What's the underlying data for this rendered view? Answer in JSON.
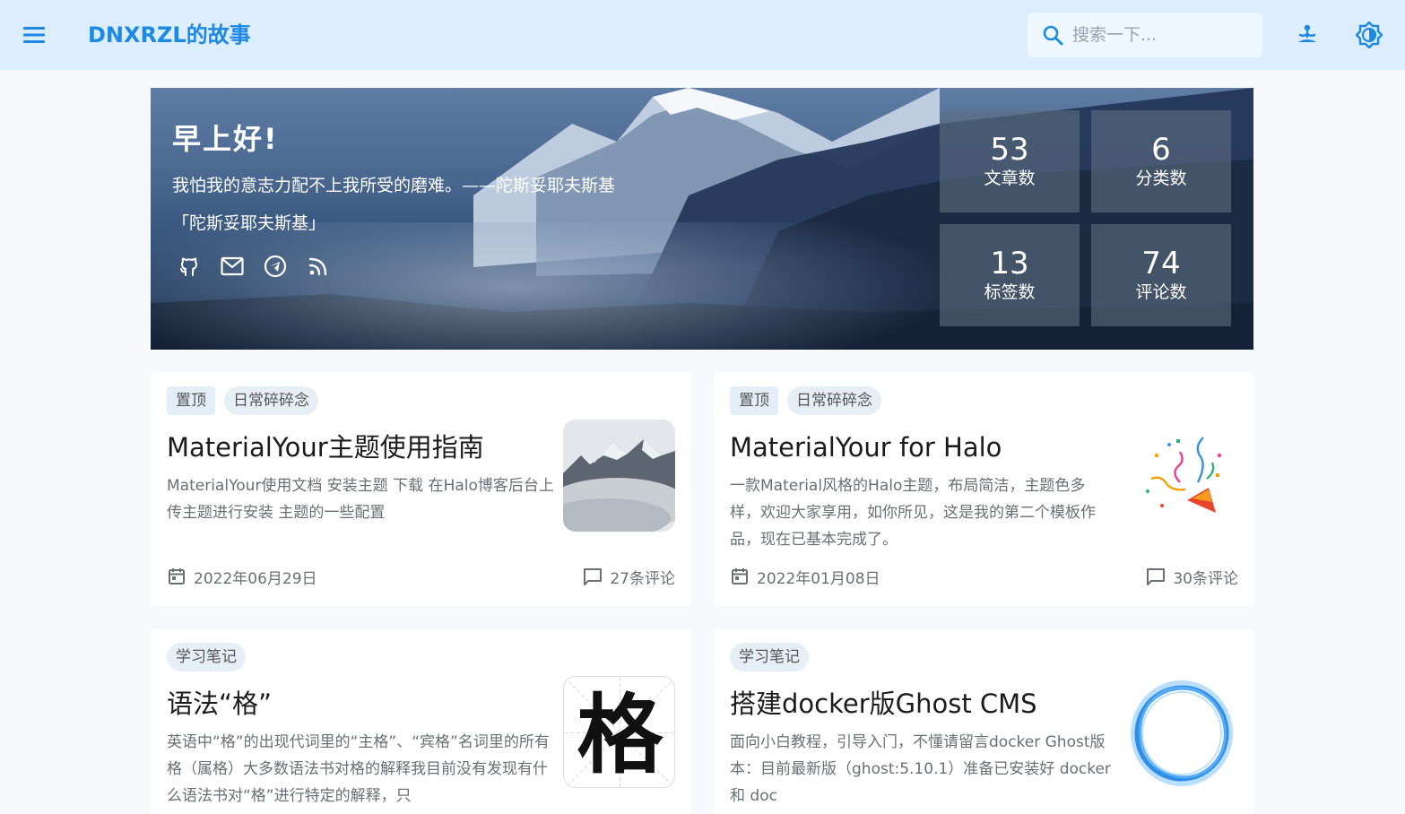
{
  "header": {
    "site_title": "DNXRZL的故事",
    "search_placeholder": "搜索一下...",
    "icons": [
      "menu-icon",
      "search-icon",
      "meditation-icon",
      "brightness-icon"
    ]
  },
  "hero": {
    "greeting": "早上好!",
    "quote": "我怕我的意志力配不上我所受的磨难。——陀斯妥耶夫斯基「陀斯妥耶夫斯基」",
    "socials": [
      "github-icon",
      "email-icon",
      "telegram-icon",
      "rss-icon"
    ],
    "stats": [
      {
        "value": "53",
        "label": "文章数"
      },
      {
        "value": "6",
        "label": "分类数"
      },
      {
        "value": "13",
        "label": "标签数"
      },
      {
        "value": "74",
        "label": "评论数"
      }
    ]
  },
  "posts": [
    {
      "tags": [
        "置顶",
        "日常碎碎念"
      ],
      "title": "MaterialYour主题使用指南",
      "excerpt": "MaterialYour使用文档 安装主题 下载 在Halo博客后台上传主题进行安装 主题的一些配置",
      "date": "2022年06月29日",
      "comments": "27条评论"
    },
    {
      "tags": [
        "置顶",
        "日常碎碎念"
      ],
      "title": "MaterialYour for Halo",
      "excerpt": "一款Material风格的Halo主题，布局简洁，主题色多样，欢迎大家享用，如你所见，这是我的第二个模板作品，现在已基本完成了。",
      "date": "2022年01月08日",
      "comments": "30条评论"
    },
    {
      "tags": [
        "学习笔记"
      ],
      "title": "语法“格”",
      "excerpt": "英语中“格”的出现代词里的“主格”、“宾格”名词里的所有格（属格）大多数语法书对格的解释我目前没有发现有什么语法书对“格”进行特定的解释，只",
      "thumb_char": "格"
    },
    {
      "tags": [
        "学习笔记"
      ],
      "title": "搭建docker版Ghost CMS",
      "excerpt": "面向小白教程，引导入门，不懂请留言docker Ghost版本：目前最新版（ghost:5.10.1）准备已安装好 docker 和 doc"
    }
  ],
  "colors": {
    "accent": "#1e88e5",
    "topbar": "#dcedfd",
    "background": "#f6f8fb"
  }
}
